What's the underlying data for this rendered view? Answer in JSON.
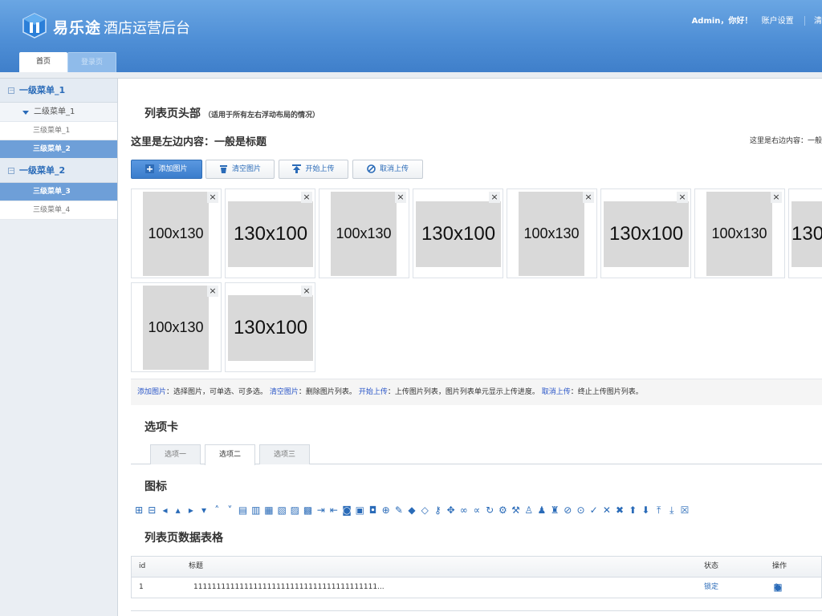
{
  "header": {
    "brand": "易乐途",
    "brand_sub": "酒店运营后台",
    "welcome": "Admin，你好！",
    "account_settings": "账户设置",
    "clear": "清",
    "tabs": [
      "首页",
      "登录页"
    ]
  },
  "sidebar": {
    "items": [
      {
        "level": 1,
        "label": "一级菜单_1",
        "icon": "collapse-icon"
      },
      {
        "level": 2,
        "label": "二级菜单_1",
        "icon": "triangle-down-icon"
      },
      {
        "level": 3,
        "label": "三级菜单_1"
      },
      {
        "level": 3,
        "label": "三级菜单_2",
        "active": true
      },
      {
        "level": 1,
        "label": "一级菜单_2",
        "icon": "collapse-icon"
      },
      {
        "level": 3,
        "label": "三级菜单_3",
        "active": true
      },
      {
        "level": 3,
        "label": "三级菜单_4"
      }
    ]
  },
  "main": {
    "list_header": "列表页头部",
    "list_header_note": "（适用于所有左右浮动布局的情况）",
    "left_title": "这里是左边内容：一般是标题",
    "right_title": "这里是右边内容：一般",
    "buttons": {
      "add": "添加图片",
      "clear": "清空图片",
      "start": "开始上传",
      "cancel": "取消上传"
    },
    "thumbs_row1": [
      "100x130",
      "130x100",
      "100x130",
      "130x100",
      "100x130",
      "130x100",
      "100x130",
      "130"
    ],
    "thumbs_row2": [
      "100x130",
      "130x100"
    ],
    "help": {
      "add_link": "添加图片",
      "add_text": "：选择图片，可单选、可多选。",
      "clear_link": "清空图片",
      "clear_text": "：删除图片列表。",
      "start_link": "开始上传",
      "start_text": "：上传图片列表，图片列表单元显示上传进度。",
      "cancel_link": "取消上传",
      "cancel_text": "：终止上传图片列表。"
    },
    "tabs_title": "选项卡",
    "tabs": [
      "选项一",
      "选项二",
      "选项三"
    ],
    "icons_title": "图标",
    "table_title": "列表页数据表格",
    "table": {
      "headers": {
        "id": "id",
        "title": "标题",
        "status": "状态",
        "action": "操作"
      },
      "rows": [
        {
          "id": "1",
          "title": "1111111111111111111111111111111111111111...",
          "status": "锁定"
        }
      ]
    }
  },
  "colors": {
    "header_top": "#6aa6e3",
    "header_bottom": "#3f7fca",
    "accent": "#2a6bb8",
    "active_menu": "#6e9fd8"
  }
}
